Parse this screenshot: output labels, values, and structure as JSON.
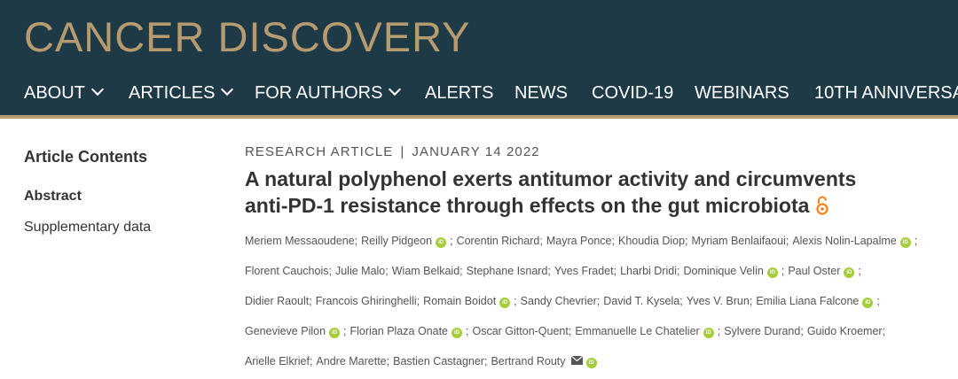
{
  "header": {
    "logo": "CANCER DISCOVERY",
    "nav": [
      {
        "label": "ABOUT",
        "dropdown": true
      },
      {
        "label": "ARTICLES",
        "dropdown": true
      },
      {
        "label": "FOR AUTHORS",
        "dropdown": true
      },
      {
        "label": "ALERTS",
        "dropdown": false
      },
      {
        "label": "NEWS",
        "dropdown": false
      },
      {
        "label": "COVID-19",
        "dropdown": false
      },
      {
        "label": "WEBINARS",
        "dropdown": false
      },
      {
        "label": "10TH ANNIVERSA",
        "dropdown": false
      }
    ]
  },
  "sidebar": {
    "title": "Article Contents",
    "items": [
      {
        "label": "Abstract",
        "active": true
      },
      {
        "label": "Supplementary data",
        "active": false
      }
    ]
  },
  "article": {
    "type": "RESEARCH ARTICLE",
    "separator": "|",
    "date": "JANUARY 14 2022",
    "title_line1": "A natural polyphenol exerts antitumor activity and circumvents",
    "title_line2": "anti-PD-1 resistance through effects on the gut microbiota",
    "open_access_icon": "open-lock-icon",
    "orcid_text": "iD",
    "author_lines": [
      [
        {
          "name": "Meriem Messaoudene",
          "orcid": false,
          "sep": ";"
        },
        {
          "name": "Reilly Pidgeon",
          "orcid": true,
          "sep": ";"
        },
        {
          "name": "Corentin Richard",
          "orcid": false,
          "sep": ";"
        },
        {
          "name": "Mayra Ponce",
          "orcid": false,
          "sep": ";"
        },
        {
          "name": "Khoudia Diop",
          "orcid": false,
          "sep": ";"
        },
        {
          "name": "Myriam Benlaifaoui",
          "orcid": false,
          "sep": ";"
        },
        {
          "name": "Alexis Nolin-Lapalme",
          "orcid": true,
          "sep": ";"
        }
      ],
      [
        {
          "name": "Florent Cauchois",
          "orcid": false,
          "sep": ";"
        },
        {
          "name": "Julie Malo",
          "orcid": false,
          "sep": ";"
        },
        {
          "name": "Wiam Belkaid",
          "orcid": false,
          "sep": ";"
        },
        {
          "name": "Stephane Isnard",
          "orcid": false,
          "sep": ";"
        },
        {
          "name": "Yves Fradet",
          "orcid": false,
          "sep": ";"
        },
        {
          "name": "Lharbi Dridi",
          "orcid": false,
          "sep": ";"
        },
        {
          "name": "Dominique Velin",
          "orcid": true,
          "sep": ";"
        },
        {
          "name": "Paul Oster",
          "orcid": true,
          "sep": ";"
        }
      ],
      [
        {
          "name": "Didier Raoult",
          "orcid": false,
          "sep": ";"
        },
        {
          "name": "Francois Ghiringhelli",
          "orcid": false,
          "sep": ";"
        },
        {
          "name": "Romain Boidot",
          "orcid": true,
          "sep": ";"
        },
        {
          "name": "Sandy Chevrier",
          "orcid": false,
          "sep": ";"
        },
        {
          "name": "David T. Kysela",
          "orcid": false,
          "sep": ";"
        },
        {
          "name": "Yves V. Brun",
          "orcid": false,
          "sep": ";"
        },
        {
          "name": "Emilia Liana Falcone",
          "orcid": true,
          "sep": ";"
        }
      ],
      [
        {
          "name": "Genevieve Pilon",
          "orcid": true,
          "sep": ";"
        },
        {
          "name": "Florian Plaza Onate",
          "orcid": true,
          "sep": ";"
        },
        {
          "name": "Oscar Gitton-Quent",
          "orcid": false,
          "sep": ";"
        },
        {
          "name": "Emmanuelle Le Chatelier",
          "orcid": true,
          "sep": ";"
        },
        {
          "name": "Sylvere Durand",
          "orcid": false,
          "sep": ";"
        },
        {
          "name": "Guido Kroemer",
          "orcid": false,
          "sep": ";"
        }
      ],
      [
        {
          "name": "Arielle Elkrief",
          "orcid": false,
          "sep": ";"
        },
        {
          "name": "Andre Marette",
          "orcid": false,
          "sep": ";"
        },
        {
          "name": "Bastien Castagner",
          "orcid": false,
          "sep": ";"
        },
        {
          "name": "Bertrand Routy",
          "orcid": true,
          "mail": true,
          "sep": ""
        }
      ]
    ]
  },
  "colors": {
    "header_bg": "#1f3a47",
    "logo_gold": "#b69a70",
    "orcid_green": "#a6ce39",
    "open_access_orange": "#f68212"
  }
}
